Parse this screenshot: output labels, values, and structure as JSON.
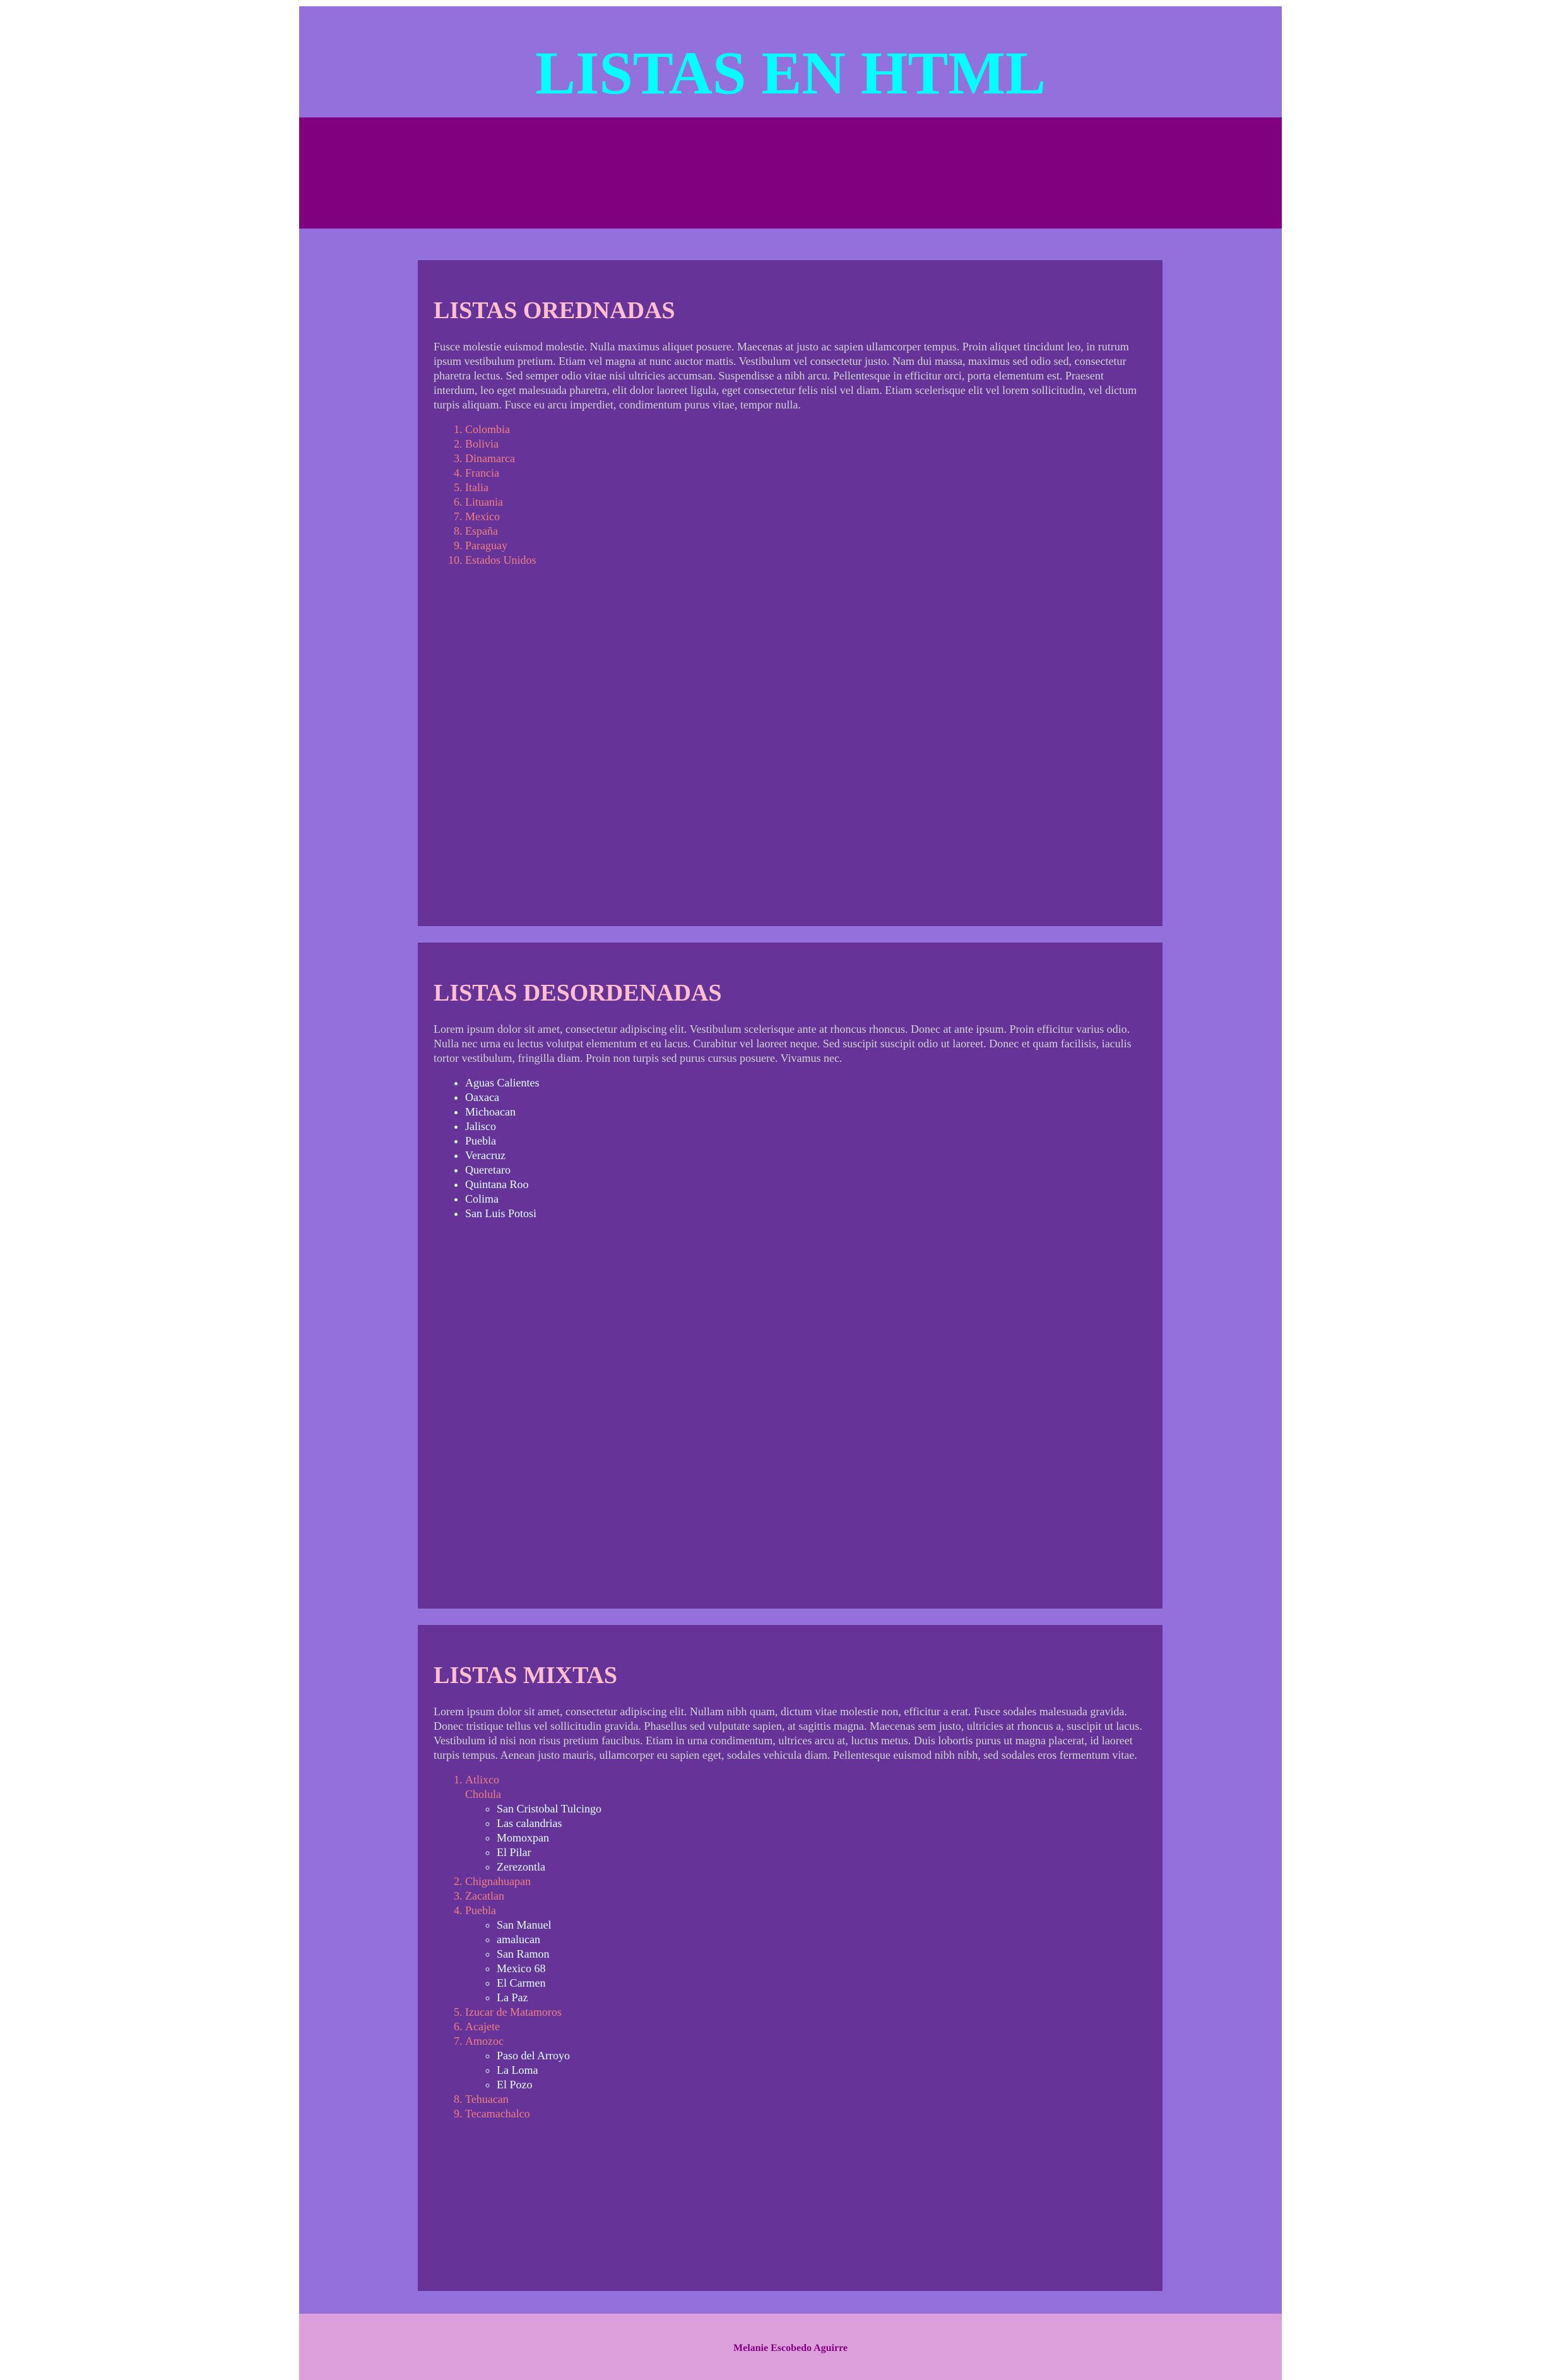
{
  "header": {
    "title": "LISTAS EN HTML"
  },
  "sections": [
    {
      "title": "LISTAS OREDNADAS",
      "text": "Fusce molestie euismod molestie. Nulla maximus aliquet posuere. Maecenas at justo ac sapien ullamcorper tempus. Proin aliquet tincidunt leo, in rutrum ipsum vestibulum pretium. Etiam vel magna at nunc auctor mattis. Vestibulum vel consectetur justo. Nam dui massa, maximus sed odio sed, consectetur pharetra lectus. Sed semper odio vitae nisi ultricies accumsan. Suspendisse a nibh arcu. Pellentesque in efficitur orci, porta elementum est. Praesent interdum, leo eget malesuada pharetra, elit dolor laoreet ligula, eget consectetur felis nisl vel diam. Etiam scelerisque elit vel lorem sollicitudin, vel dictum turpis aliquam. Fusce eu arcu imperdiet, condimentum purus vitae, tempor nulla.",
      "items": [
        "Colombia",
        "Bolivia",
        "Dinamarca",
        "Francia",
        "Italia",
        "Lituania",
        "Mexico",
        "España",
        "Paraguay",
        "Estados Unidos"
      ]
    },
    {
      "title": "LISTAS DESORDENADAS",
      "text": "Lorem ipsum dolor sit amet, consectetur adipiscing elit. Vestibulum scelerisque ante at rhoncus rhoncus. Donec at ante ipsum. Proin efficitur varius odio. Nulla nec urna eu lectus volutpat elementum et eu lacus. Curabitur vel laoreet neque. Sed suscipit suscipit odio ut laoreet. Donec et quam facilisis, iaculis tortor vestibulum, fringilla diam. Proin non turpis sed purus cursus posuere. Vivamus nec.",
      "items": [
        "Aguas Calientes",
        "Oaxaca",
        "Michoacan",
        "Jalisco",
        "Puebla",
        "Veracruz",
        "Queretaro",
        "Quintana Roo",
        "Colima",
        "San Luis Potosi"
      ]
    },
    {
      "title": "LISTAS MIXTAS",
      "text": "Lorem ipsum dolor sit amet, consectetur adipiscing elit. Nullam nibh quam, dictum vitae molestie non, efficitur a erat. Fusce sodales malesuada gravida. Donec tristique tellus vel sollicitudin gravida. Phasellus sed vulputate sapien, at sagittis magna. Maecenas sem justo, ultricies at rhoncus a, suscipit ut lacus. Vestibulum id nisi non risus pretium faucibus. Etiam in urna condimentum, ultrices arcu at, luctus metus. Duis lobortis purus ut magna placerat, id laoreet turpis tempus. Aenean justo mauris, ullamcorper eu sapien eget, sodales vehicula diam. Pellentesque euismod nibh nibh, sed sodales eros fermentum vitae.",
      "items": [
        {
          "label": "Atlixco",
          "sublabel": "Cholula",
          "children": [
            "San Cristobal Tulcingo",
            "Las calandrias",
            "Momoxpan",
            "El Pilar",
            "Zerezontla"
          ]
        },
        {
          "label": "Chignahuapan",
          "children": []
        },
        {
          "label": "Zacatlan",
          "children": []
        },
        {
          "label": "Puebla",
          "children": [
            "San Manuel",
            "amalucan",
            "San Ramon",
            "Mexico 68",
            "El Carmen",
            "La Paz"
          ]
        },
        {
          "label": "Izucar de Matamoros",
          "children": []
        },
        {
          "label": "Acajete",
          "children": []
        },
        {
          "label": "Amozoc",
          "children": [
            "Paso del Arroyo",
            "La Loma",
            "El Pozo"
          ]
        },
        {
          "label": "Tehuacan",
          "children": []
        },
        {
          "label": "Tecamachalco",
          "children": []
        }
      ]
    }
  ],
  "footer": {
    "text": "Melanie Escobedo Aguirre"
  }
}
